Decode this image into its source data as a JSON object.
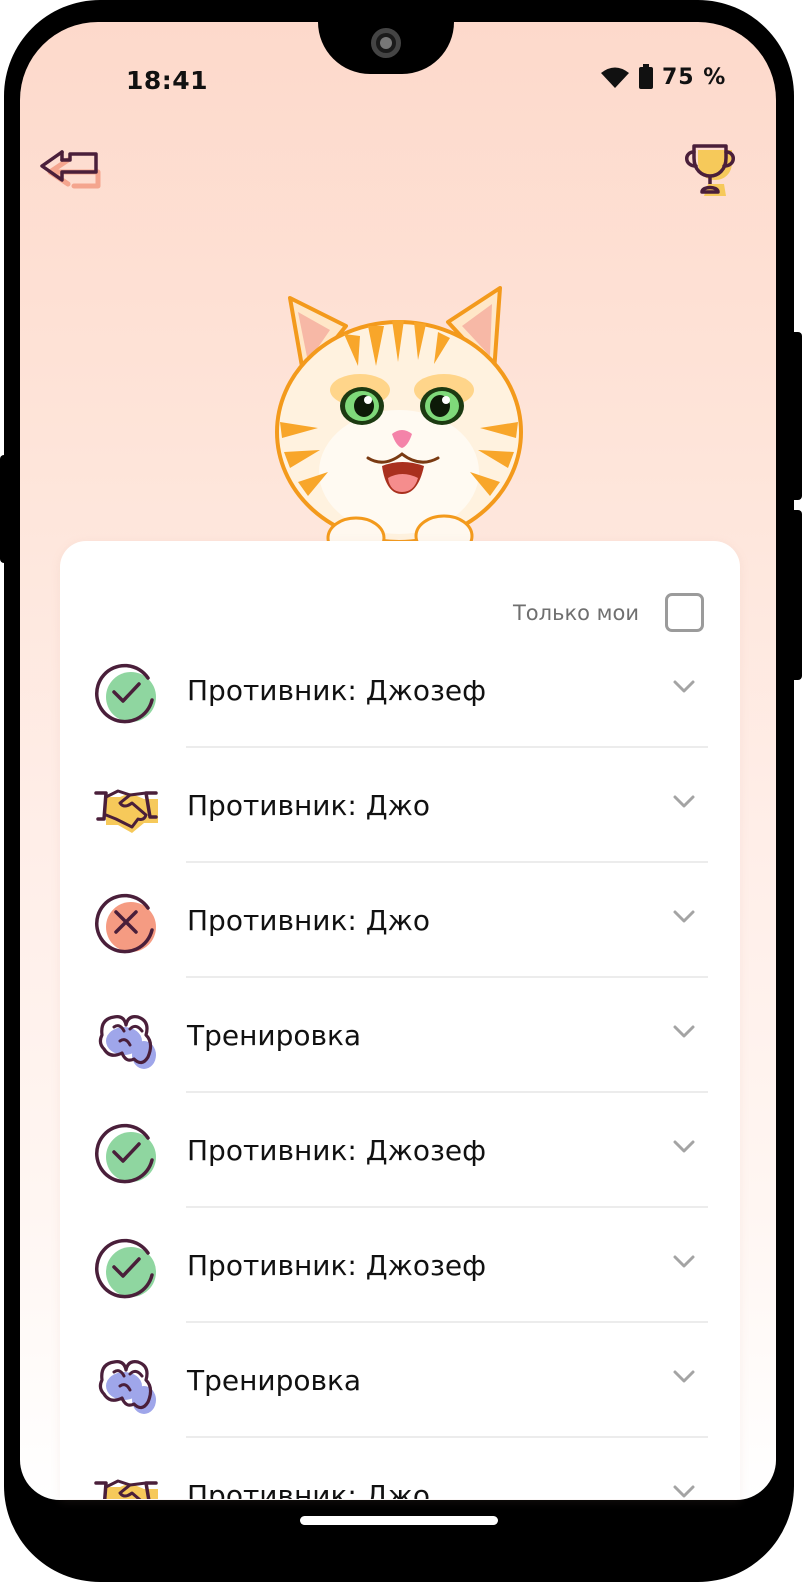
{
  "status_bar": {
    "time": "18:41",
    "battery": "75 %",
    "icons": [
      "wifi-icon",
      "battery-icon"
    ]
  },
  "header": {
    "back_icon": "back-arrow-icon",
    "trophy_icon": "trophy-icon"
  },
  "mascot": "cat-illustration",
  "filter": {
    "label": "Только мои",
    "checked": false
  },
  "games": [
    {
      "result": "win",
      "icon": "check-circle-icon",
      "label": "Противник: Джозеф"
    },
    {
      "result": "draw",
      "icon": "handshake-icon",
      "label": "Противник: Джо"
    },
    {
      "result": "loss",
      "icon": "cross-circle-icon",
      "label": "Противник: Джо"
    },
    {
      "result": "training",
      "icon": "training-icon",
      "label": "Тренировка"
    },
    {
      "result": "win",
      "icon": "check-circle-icon",
      "label": "Противник: Джозеф"
    },
    {
      "result": "win",
      "icon": "check-circle-icon",
      "label": "Противник: Джозеф"
    },
    {
      "result": "training",
      "icon": "training-icon",
      "label": "Тренировка"
    },
    {
      "result": "draw",
      "icon": "handshake-icon",
      "label": "Противник: Джо"
    }
  ],
  "colors": {
    "win": "#8fd6a0",
    "loss": "#f59b82",
    "draw": "#f6c95a",
    "training": "#9fa6ea",
    "outline": "#4a1f3a",
    "background_top": "#fdd9cb"
  }
}
